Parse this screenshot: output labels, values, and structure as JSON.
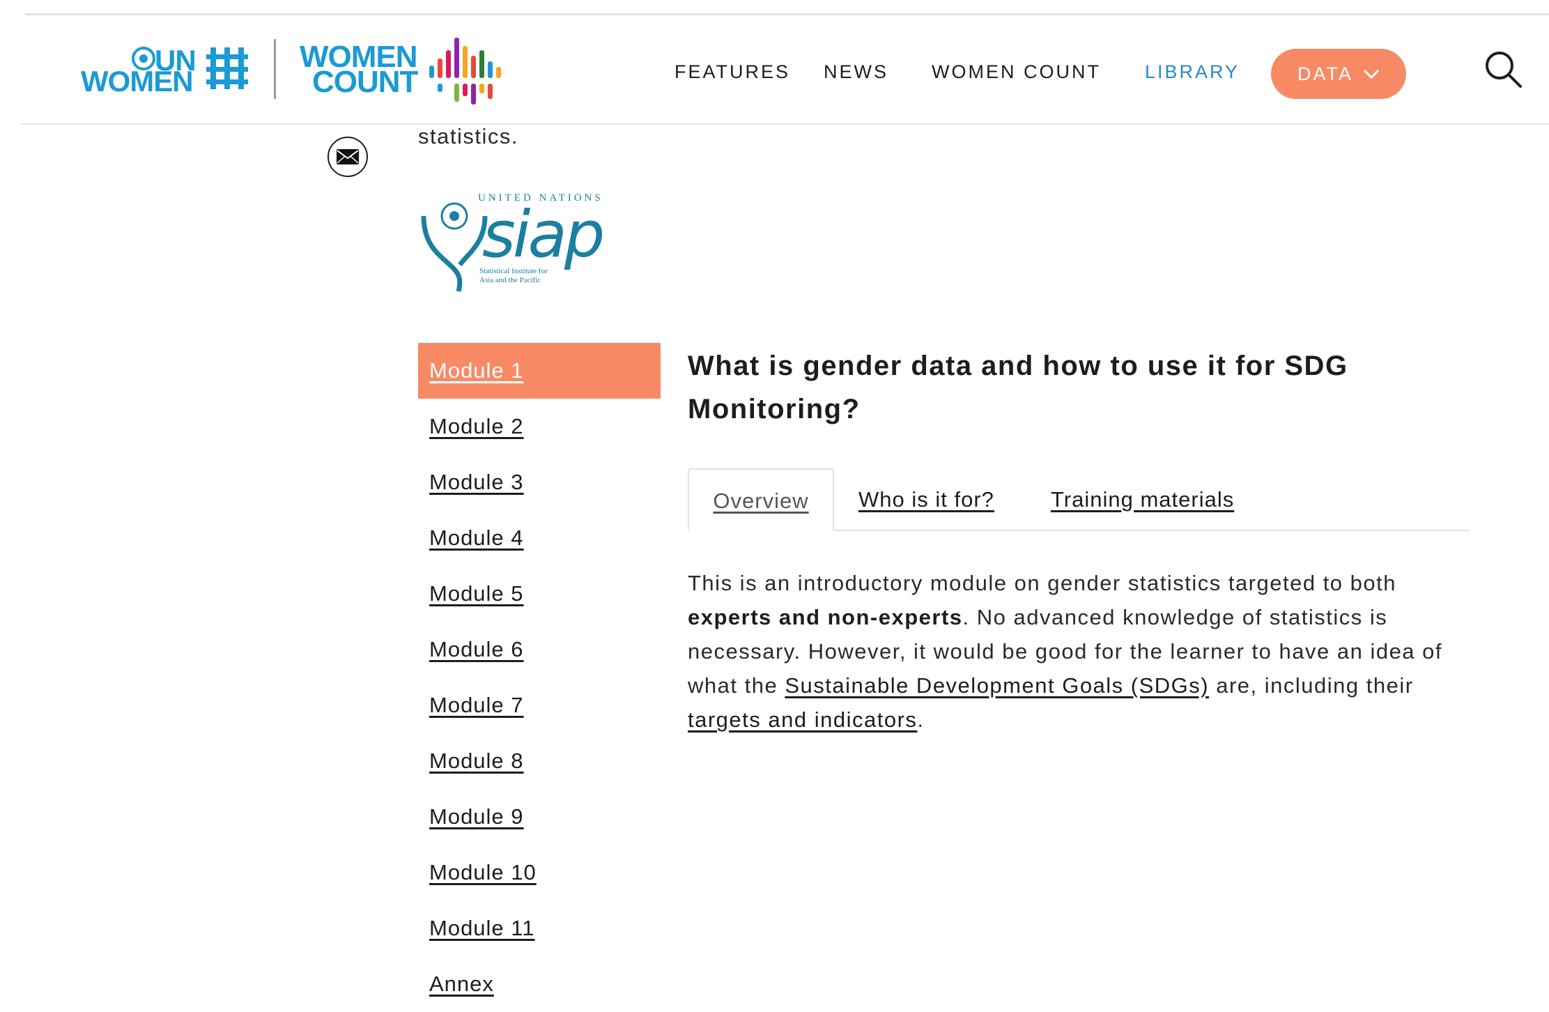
{
  "header": {
    "unwomen_logo": {
      "line1": "UN",
      "line2": "WOMEN"
    },
    "womencount_logo": {
      "line1": "WOMEN",
      "line2": "COUNT"
    },
    "nav": {
      "features": "FEATURES",
      "news": "NEWS",
      "women_count": "WOMEN COUNT",
      "library": "LIBRARY",
      "data": "DATA"
    },
    "icons": {
      "search": "search-icon",
      "data_dropdown": "chevron-down-icon"
    },
    "colors": {
      "accent": "#f78a65",
      "brand_blue": "#1a9ad6",
      "library_active": "#2a88c8"
    }
  },
  "share": {
    "icon": "envelope-icon"
  },
  "intro_fragment": "statistics.",
  "partner_logo": {
    "top": "UNITED NATIONS",
    "word": "siap",
    "sub1": "Statistical Institute for",
    "sub2": "Asia and the Pacific"
  },
  "sidebar": {
    "items": [
      {
        "label": "Module 1",
        "active": true
      },
      {
        "label": "Module 2"
      },
      {
        "label": "Module 3"
      },
      {
        "label": "Module 4"
      },
      {
        "label": "Module 5"
      },
      {
        "label": "Module 6"
      },
      {
        "label": "Module 7"
      },
      {
        "label": "Module 8"
      },
      {
        "label": "Module 9"
      },
      {
        "label": "Module 10"
      },
      {
        "label": "Module 11"
      },
      {
        "label": "Annex"
      }
    ]
  },
  "main": {
    "title": "What is gender data and how to use it for SDG Monitoring?",
    "tabs": [
      {
        "label": "Overview",
        "active": true
      },
      {
        "label": "Who is it for?"
      },
      {
        "label": "Training materials"
      }
    ],
    "overview": {
      "p1": "This is an introductory module on gender statistics targeted to both ",
      "bold": "experts and non-experts",
      "p2": ". No advanced knowledge of statistics is necessary. However, it would be good for the learner to have an idea of what the ",
      "link1": "Sustainable Development Goals (SDGs)",
      "p3": " are, including their ",
      "link2": "targets and indicators",
      "p4": "."
    }
  }
}
